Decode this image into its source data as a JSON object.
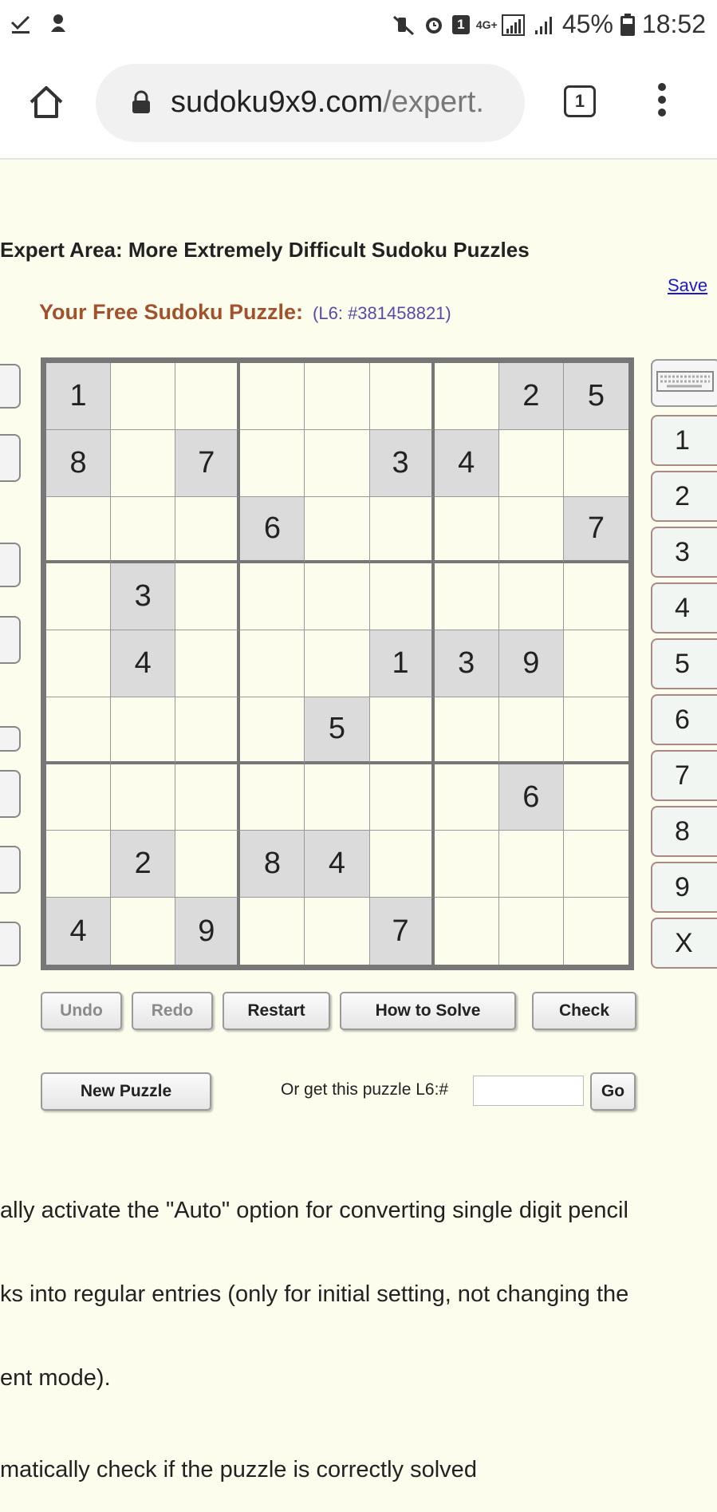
{
  "status_bar": {
    "battery": "45%",
    "time": "18:52",
    "network": "4G+",
    "notification_count": "1"
  },
  "browser": {
    "url_domain": "sudoku9x9.com",
    "url_path": "/expert.",
    "tab_count": "1"
  },
  "page": {
    "title": "Expert Area: More Extremely Difficult Sudoku Puzzles",
    "save_label": "Save",
    "puzzle_heading": "Your Free Sudoku Puzzle:",
    "puzzle_id": "(L6: #381458821)"
  },
  "grid": [
    [
      "1",
      "",
      "",
      "",
      "",
      "",
      "",
      "2",
      "5"
    ],
    [
      "8",
      "",
      "7",
      "",
      "",
      "3",
      "4",
      "",
      ""
    ],
    [
      "",
      "",
      "",
      "6",
      "",
      "",
      "",
      "",
      "7"
    ],
    [
      "",
      "3",
      "",
      "",
      "",
      "",
      "",
      "",
      ""
    ],
    [
      "",
      "4",
      "",
      "",
      "",
      "1",
      "3",
      "9",
      ""
    ],
    [
      "",
      "",
      "",
      "",
      "5",
      "",
      "",
      "",
      ""
    ],
    [
      "",
      "",
      "",
      "",
      "",
      "",
      "",
      "6",
      ""
    ],
    [
      "",
      "2",
      "",
      "8",
      "4",
      "",
      "",
      "",
      ""
    ],
    [
      "4",
      "",
      "9",
      "",
      "",
      "7",
      "",
      "",
      ""
    ]
  ],
  "numpad": [
    "1",
    "2",
    "3",
    "4",
    "5",
    "6",
    "7",
    "8",
    "9",
    "X"
  ],
  "buttons": {
    "undo": "Undo",
    "redo": "Redo",
    "restart": "Restart",
    "how_to_solve": "How to Solve",
    "check": "Check",
    "new_puzzle": "New Puzzle",
    "go": "Go"
  },
  "get_puzzle": {
    "label": "Or get this puzzle L6:#",
    "value": ""
  },
  "info_lines": [
    "ally activate the \"Auto\" option for converting single digit pencil",
    "ks into regular entries (only for initial setting, not changing the",
    "ent mode).",
    "matically check if the puzzle is correctly solved"
  ],
  "colors": {
    "page_bg": "#fdfdee",
    "given_cell_bg": "#dbdbdb",
    "heading_brown": "#a0522d",
    "puzzle_id_purple": "#5a4aa8",
    "link_blue": "#1a1acc"
  }
}
